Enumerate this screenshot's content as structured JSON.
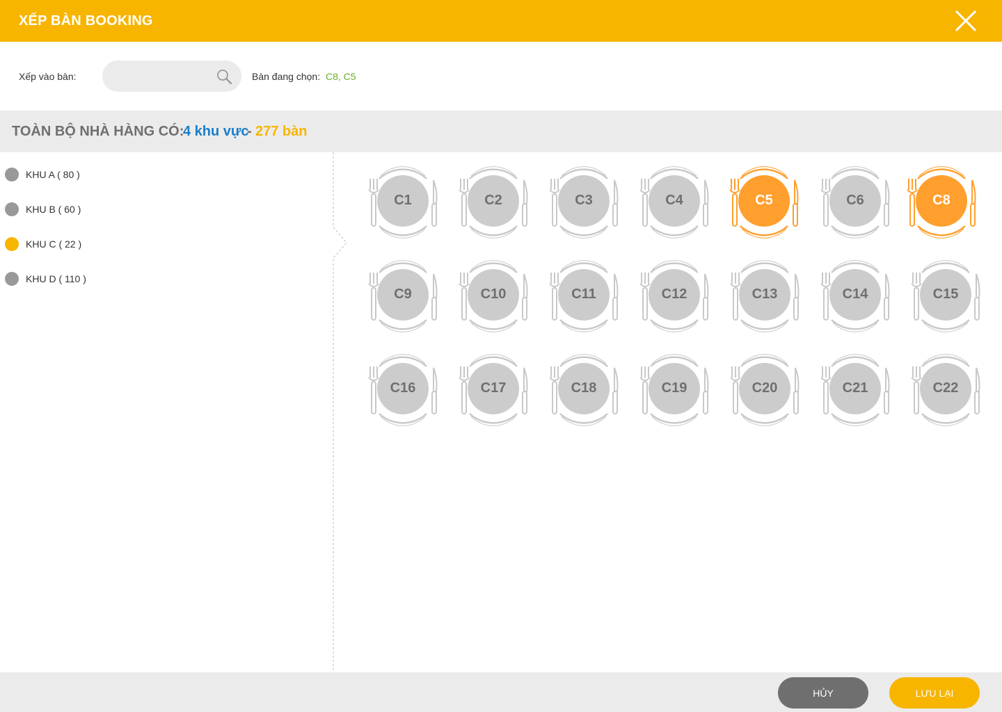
{
  "header": {
    "title": "XẾP BÀN BOOKING"
  },
  "toolbar": {
    "assign_label": "Xếp vào bàn:",
    "search_value": "",
    "selected_label": "Bàn đang chọn:",
    "selected_value": "C8, C5"
  },
  "summary": {
    "label": "TOÀN BỘ NHÀ HÀNG CÓ:",
    "areas": "4 khu vực",
    "separator": "-",
    "tables": "277 bàn"
  },
  "zones": [
    {
      "label": "KHU A ( 80 )",
      "active": false
    },
    {
      "label": "KHU B ( 60 )",
      "active": false
    },
    {
      "label": "KHU C ( 22 )",
      "active": true
    },
    {
      "label": "KHU D ( 110 )",
      "active": false
    }
  ],
  "tables": [
    {
      "label": "C1",
      "selected": false
    },
    {
      "label": "C2",
      "selected": false
    },
    {
      "label": "C3",
      "selected": false
    },
    {
      "label": "C4",
      "selected": false
    },
    {
      "label": "C5",
      "selected": true
    },
    {
      "label": "C6",
      "selected": false
    },
    {
      "label": "C8",
      "selected": true
    },
    {
      "label": "C9",
      "selected": false
    },
    {
      "label": "C10",
      "selected": false
    },
    {
      "label": "C11",
      "selected": false
    },
    {
      "label": "C12",
      "selected": false
    },
    {
      "label": "C13",
      "selected": false
    },
    {
      "label": "C14",
      "selected": false
    },
    {
      "label": "C15",
      "selected": false
    },
    {
      "label": "C16",
      "selected": false
    },
    {
      "label": "C17",
      "selected": false
    },
    {
      "label": "C18",
      "selected": false
    },
    {
      "label": "C19",
      "selected": false
    },
    {
      "label": "C20",
      "selected": false
    },
    {
      "label": "C21",
      "selected": false
    },
    {
      "label": "C22",
      "selected": false
    }
  ],
  "footer": {
    "cancel_label": "HỦY",
    "save_label": "LƯU LẠI"
  },
  "colors": {
    "brand": "#f7b500",
    "selected_table": "#ff9f2e",
    "table_idle": "#cccccc",
    "selected_text": "#6cae2b",
    "area_count": "#1a7fcb"
  },
  "icons": {
    "close": "close-icon",
    "search": "search-icon",
    "table": "plate-cutlery-icon"
  }
}
